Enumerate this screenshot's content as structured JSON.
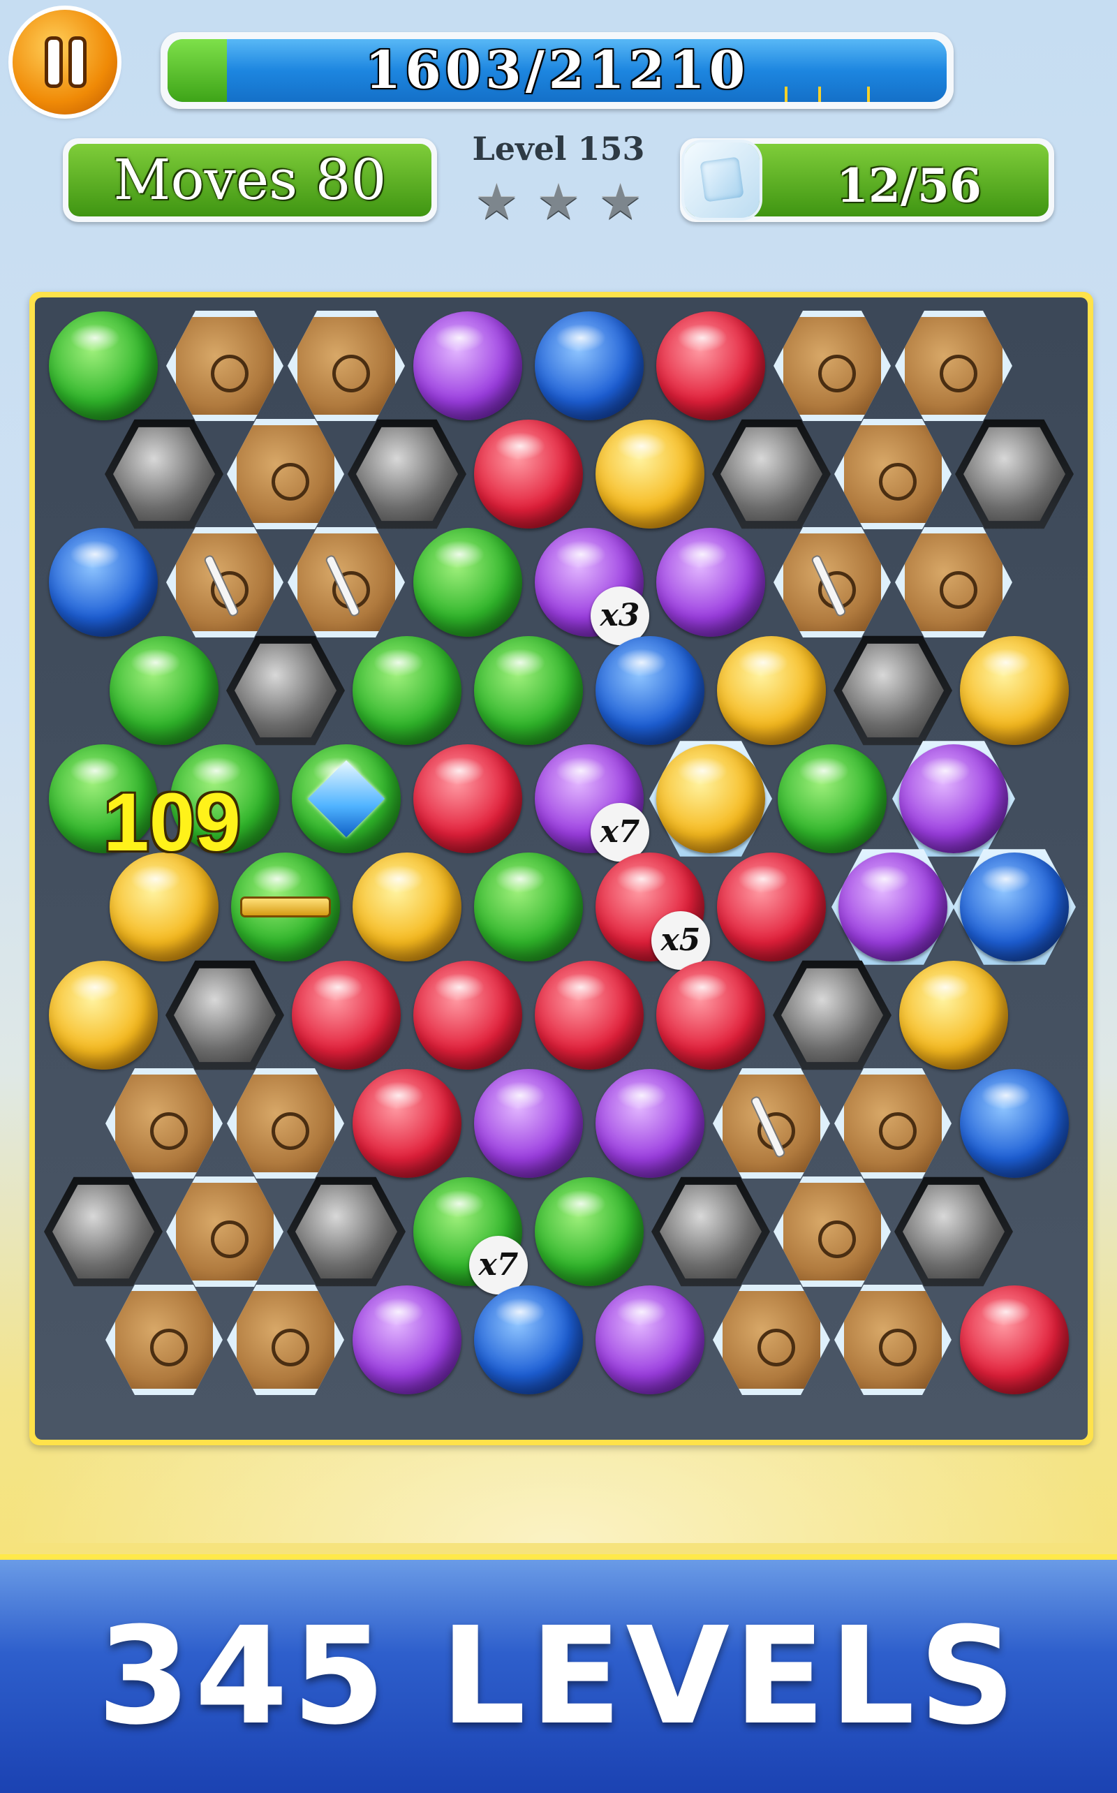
{
  "hud": {
    "score_text": "1603/21210",
    "score_progress": 0.076,
    "moves_label": "Moves 80",
    "level_label": "Level 153",
    "stars_earned": 0,
    "stars_total": 3,
    "goal_text": "12/56",
    "goal_icon": "ice-cube-icon"
  },
  "board": {
    "rows": [
      [
        "green",
        "crate",
        "crate",
        "purple",
        "blue",
        "red",
        "crate",
        "crate"
      ],
      [
        "metal",
        "crate",
        "metal",
        "red",
        "yellow",
        "metal",
        "crate",
        "metal"
      ],
      [
        "blue",
        "crate-cracked",
        "crate-cracked",
        "green",
        "purple-x3",
        "purple",
        "crate-cracked",
        "crate"
      ],
      [
        "green",
        "metal",
        "green",
        "green",
        "blue",
        "yellow",
        "metal",
        "yellow"
      ],
      [
        "green",
        "green",
        "green-diamond",
        "red",
        "purple-x7",
        "yellow-frozen",
        "green",
        "purple-frozen"
      ],
      [
        "yellow",
        "green-stripe",
        "yellow",
        "green",
        "red-x5",
        "red",
        "purple-frozen",
        "blue-frozen"
      ],
      [
        "yellow",
        "metal",
        "red",
        "red",
        "red",
        "red",
        "metal",
        "yellow"
      ],
      [
        "crate",
        "crate",
        "red",
        "purple",
        "purple",
        "crate-cracked",
        "crate",
        "blue"
      ],
      [
        "metal",
        "crate",
        "metal",
        "green-x7",
        "green",
        "metal",
        "crate",
        "metal"
      ],
      [
        "crate",
        "crate",
        "purple",
        "blue",
        "purple",
        "crate",
        "crate",
        "red"
      ]
    ],
    "multipliers": [
      "x3",
      "x7",
      "x5",
      "x7"
    ],
    "floating_score": "109"
  },
  "banner": {
    "text": "345 LEVELS"
  },
  "colors": {
    "hud_green": "#3f9512",
    "progress_blue": "#1d86e0",
    "board_frame": "#ffe24a",
    "banner_blue": "#2e5fcc"
  }
}
